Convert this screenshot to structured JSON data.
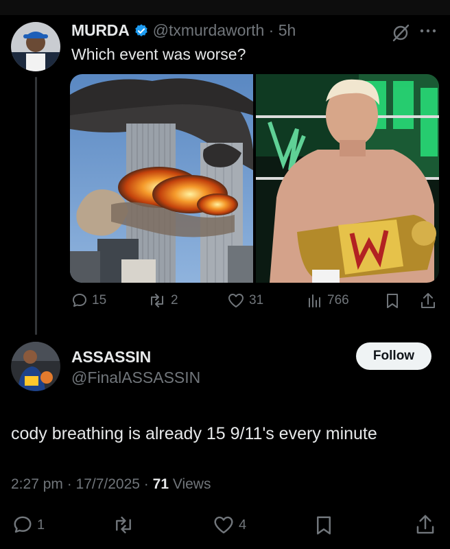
{
  "parent_tweet": {
    "display_name": "MURDA",
    "handle": "@txmurdaworth",
    "time": "5h",
    "text": "Which event was worse?",
    "icons": {
      "verified": "verified-badge-icon",
      "grok": "grok-icon",
      "more": "more-icon"
    },
    "actions": {
      "replies": "15",
      "reposts": "2",
      "likes": "31",
      "views": "766"
    }
  },
  "reply_tweet": {
    "display_name": "ASSASSIN",
    "handle": "@FinalASSASSIN",
    "follow_label": "Follow",
    "text": "cody breathing is already 15 9/11's every minute",
    "timestamp": "2:27 pm · 17/7/2025 · ",
    "views_count": "71",
    "views_label": " Views",
    "actions": {
      "replies": "1",
      "reposts": "",
      "likes": "4"
    }
  },
  "colors": {
    "background": "#000000",
    "text_primary": "#e7e9ea",
    "text_secondary": "#71767b",
    "verified": "#1d9bf0",
    "follow_bg": "#eff3f4"
  }
}
